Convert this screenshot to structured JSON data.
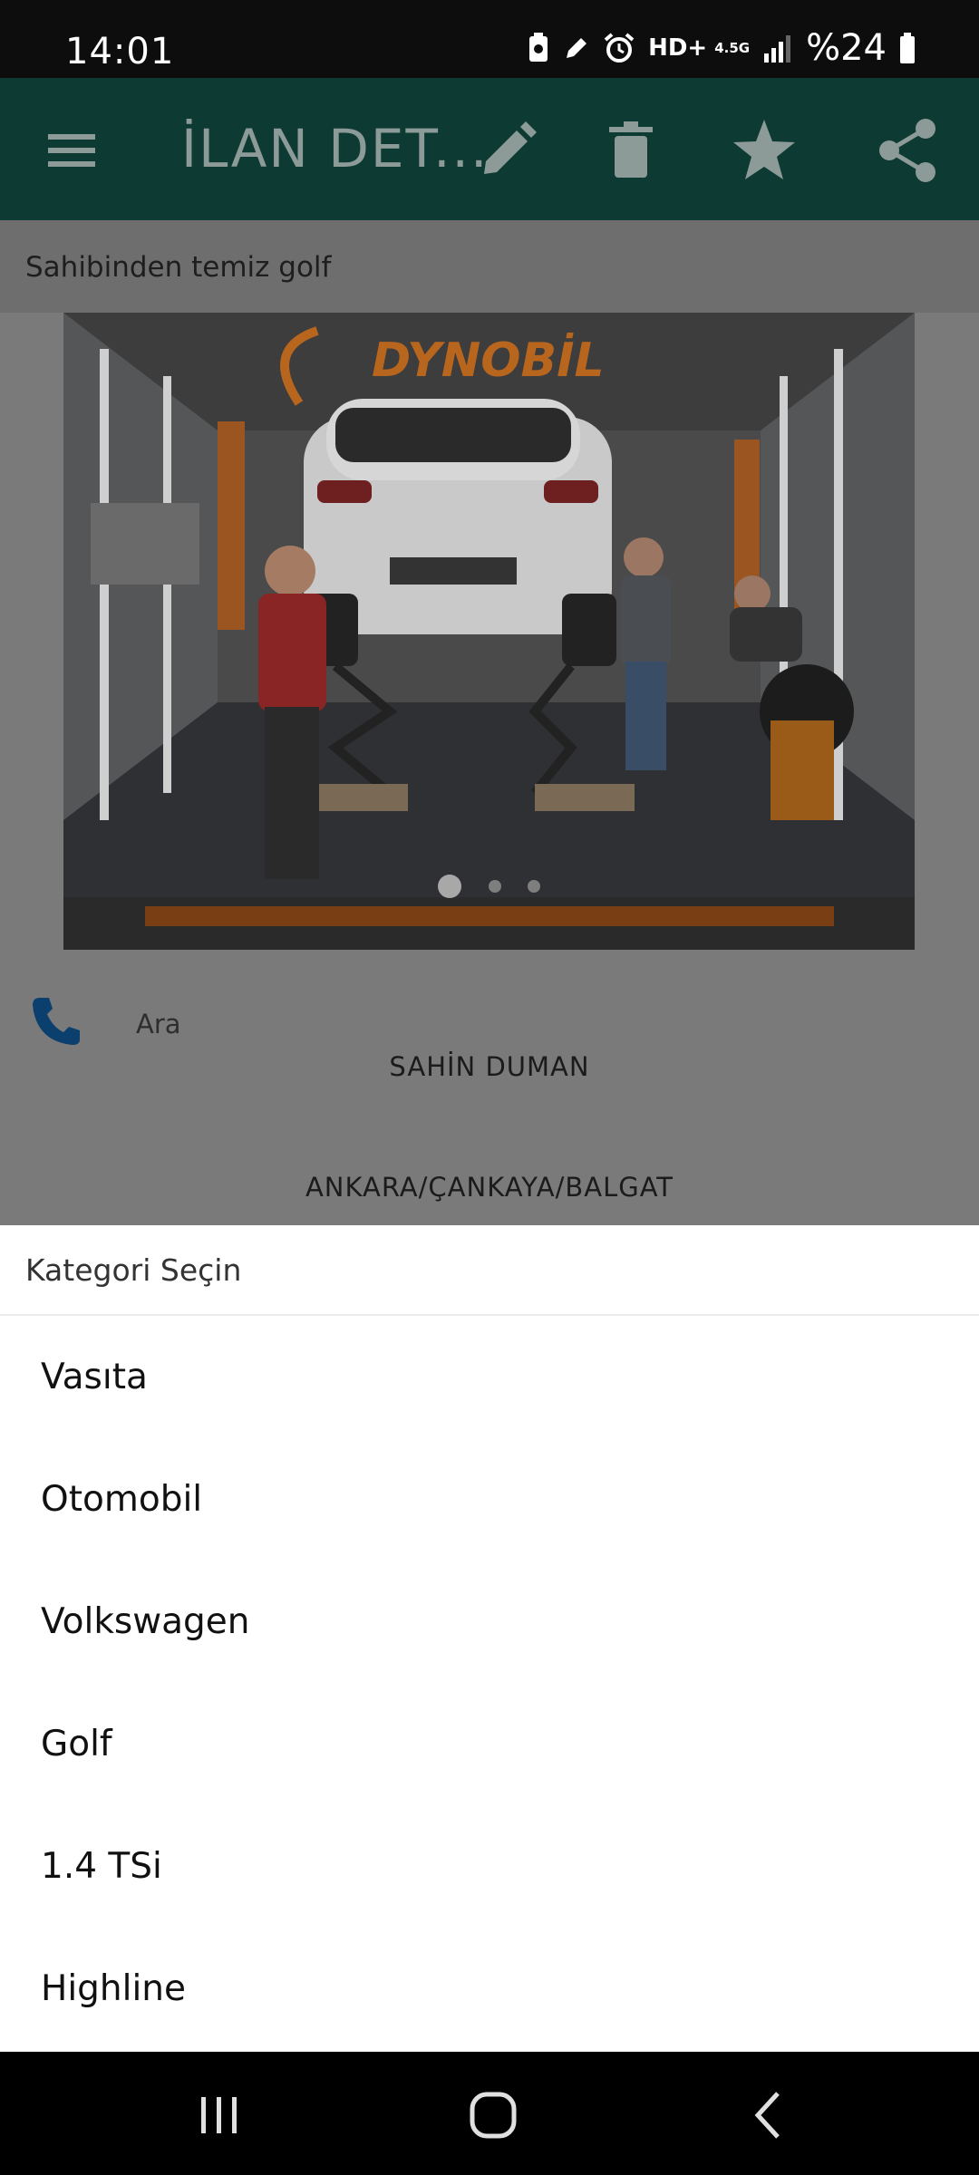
{
  "status_bar": {
    "time": "14:01",
    "network": "HD+",
    "signal_label": "4.5G",
    "battery": "%24"
  },
  "app_bar": {
    "title": "İLAN DET...",
    "icons": [
      "menu-icon",
      "edit-icon",
      "delete-icon",
      "star-icon",
      "share-icon"
    ]
  },
  "listing": {
    "title": "Sahibinden temiz golf",
    "photo": {
      "description": "workshop-car-photo",
      "page_count": 3,
      "current_page": 1
    },
    "call_label": "Ara",
    "seller_name": "SAHİN DUMAN",
    "location": "ANKARA/ÇANKAYA/BALGAT"
  },
  "category_sheet": {
    "title": "Kategori Seçin",
    "items": [
      "Vasıta",
      "Otomobil",
      "Volkswagen",
      "Golf",
      "1.4 TSi",
      "Highline"
    ]
  },
  "colors": {
    "app_bar": "#0d3a32",
    "scrim_overlay": "#7a7a7a",
    "call_icon": "#0a3f6e",
    "sheet_background": "#ffffff"
  }
}
